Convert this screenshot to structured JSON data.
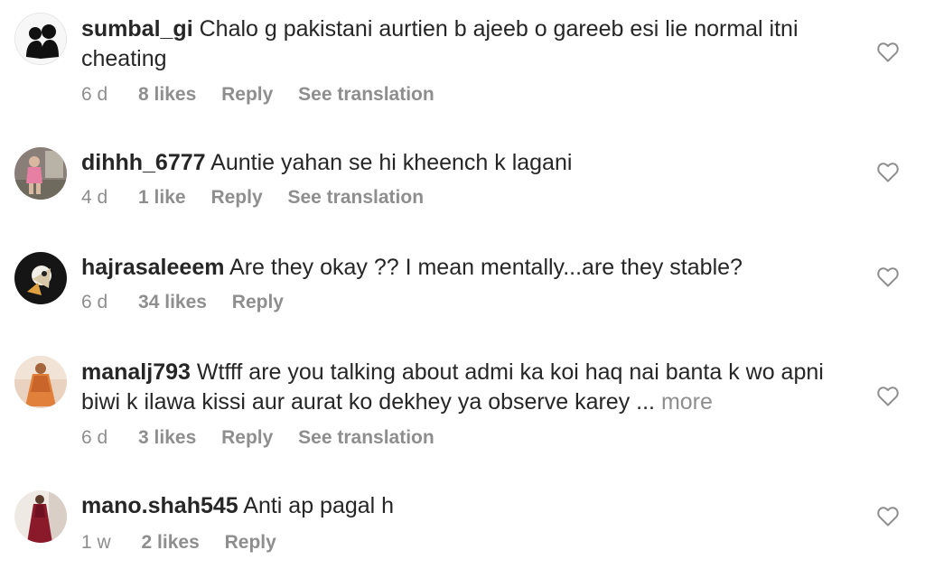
{
  "comments": [
    {
      "username": "sumbal_gi",
      "text": "Chalo g pakistani aurtien b ajeeb o gareeb esi lie normal itni cheating",
      "time": "6 d",
      "likes": "8 likes",
      "reply": "Reply",
      "translation": "See translation",
      "avatar_icon": "couple-silhouette-avatar",
      "like_icon": "heart-outline-icon"
    },
    {
      "username": "dihhh_6777",
      "text": "Auntie yahan se hi kheench k lagani",
      "time": "4 d",
      "likes": "1 like",
      "reply": "Reply",
      "translation": "See translation",
      "avatar_icon": "child-photo-avatar",
      "like_icon": "heart-outline-icon"
    },
    {
      "username": "hajrasaleeem",
      "text": "Are they okay ?? I mean mentally...are they stable?",
      "time": "6 d",
      "likes": "34 likes",
      "reply": "Reply",
      "avatar_icon": "dark-photo-avatar",
      "like_icon": "heart-outline-icon"
    },
    {
      "username": "manalj793",
      "text": "Wtfff are you talking about admi ka koi haq nai banta k wo apni biwi k ilawa kissi aur aurat ko dekhey ya observe karey ...",
      "more": "more",
      "time": "6 d",
      "likes": "3 likes",
      "reply": "Reply",
      "translation": "See translation",
      "avatar_icon": "orange-dress-avatar",
      "like_icon": "heart-outline-icon"
    },
    {
      "username": "mano.shah545",
      "text": "Anti ap pagal h",
      "time": "1 w",
      "likes": "2 likes",
      "reply": "Reply",
      "avatar_icon": "maroon-dress-avatar",
      "like_icon": "heart-outline-icon"
    }
  ]
}
